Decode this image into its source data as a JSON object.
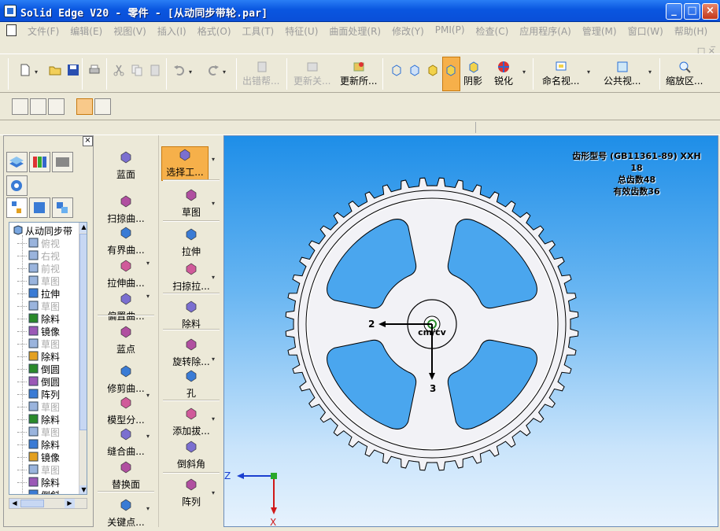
{
  "window": {
    "title": "Solid Edge V20 - 零件 - [从动同步带轮.par]"
  },
  "menu": {
    "items": [
      "文件(F)",
      "编辑(E)",
      "视图(V)",
      "插入(I)",
      "格式(O)",
      "工具(T)",
      "特征(U)",
      "曲面处理(R)",
      "修改(Y)",
      "PMI(P)",
      "检查(C)",
      "应用程序(A)",
      "管理(M)",
      "窗口(W)",
      "帮助(H)"
    ]
  },
  "toolbar": {
    "label_fix": "出错帮...",
    "label_update": "更新关...",
    "label_update_all": "更新所...",
    "label_shade": "阴影",
    "label_sharpen": "锐化",
    "label_named_view": "命名视...",
    "label_common_view": "公共视...",
    "label_zoom": "缩放区..."
  },
  "ribbon_left": {
    "items": [
      "蓝面",
      "扫掠曲...",
      "有界曲...",
      "拉伸曲...",
      "偏置曲...",
      "蓝点",
      "修剪曲...",
      "模型分...",
      "缝合曲...",
      "替换面",
      "关键点..."
    ]
  },
  "ribbon_right": {
    "items": [
      "选择工...",
      "草图",
      "拉伸",
      "扫掠拉...",
      "除料",
      "旋转除...",
      "孔",
      "添加拔...",
      "倒斜角",
      "阵列"
    ]
  },
  "tree": {
    "root": "从动同步带",
    "items": [
      {
        "label": "俯视",
        "dim": true
      },
      {
        "label": "右视",
        "dim": true
      },
      {
        "label": "前视",
        "dim": true
      },
      {
        "label": "草图",
        "dim": true
      },
      {
        "label": "拉伸",
        "dim": false
      },
      {
        "label": "草图",
        "dim": true
      },
      {
        "label": "除料",
        "dim": false
      },
      {
        "label": "镜像",
        "dim": false
      },
      {
        "label": "草图",
        "dim": true
      },
      {
        "label": "除料",
        "dim": false
      },
      {
        "label": "倒圆",
        "dim": false
      },
      {
        "label": "倒圆",
        "dim": false
      },
      {
        "label": "阵列",
        "dim": false
      },
      {
        "label": "草图",
        "dim": true
      },
      {
        "label": "除料",
        "dim": false
      },
      {
        "label": "草图",
        "dim": true
      },
      {
        "label": "除料",
        "dim": false
      },
      {
        "label": "镜像",
        "dim": false
      },
      {
        "label": "草图",
        "dim": true
      },
      {
        "label": "除料",
        "dim": false
      },
      {
        "label": "倒斜",
        "dim": false
      }
    ]
  },
  "annotation": {
    "line1": "齿形型号 (GB11361-89) XXH",
    "line2": "18",
    "line3": "总齿数48",
    "line4": "有效齿数36"
  },
  "model": {
    "teeth_total": 48,
    "teeth_effective": 36,
    "spokes": 4,
    "hub_label": "cm/cv",
    "axis_a": "2",
    "axis_b": "3"
  },
  "triad": {
    "z": "Z",
    "x": "X"
  },
  "colors": {
    "title_blue": "#0a56e0",
    "viewport_top": "#1e8ee8",
    "active_tool": "#f6b04a"
  }
}
